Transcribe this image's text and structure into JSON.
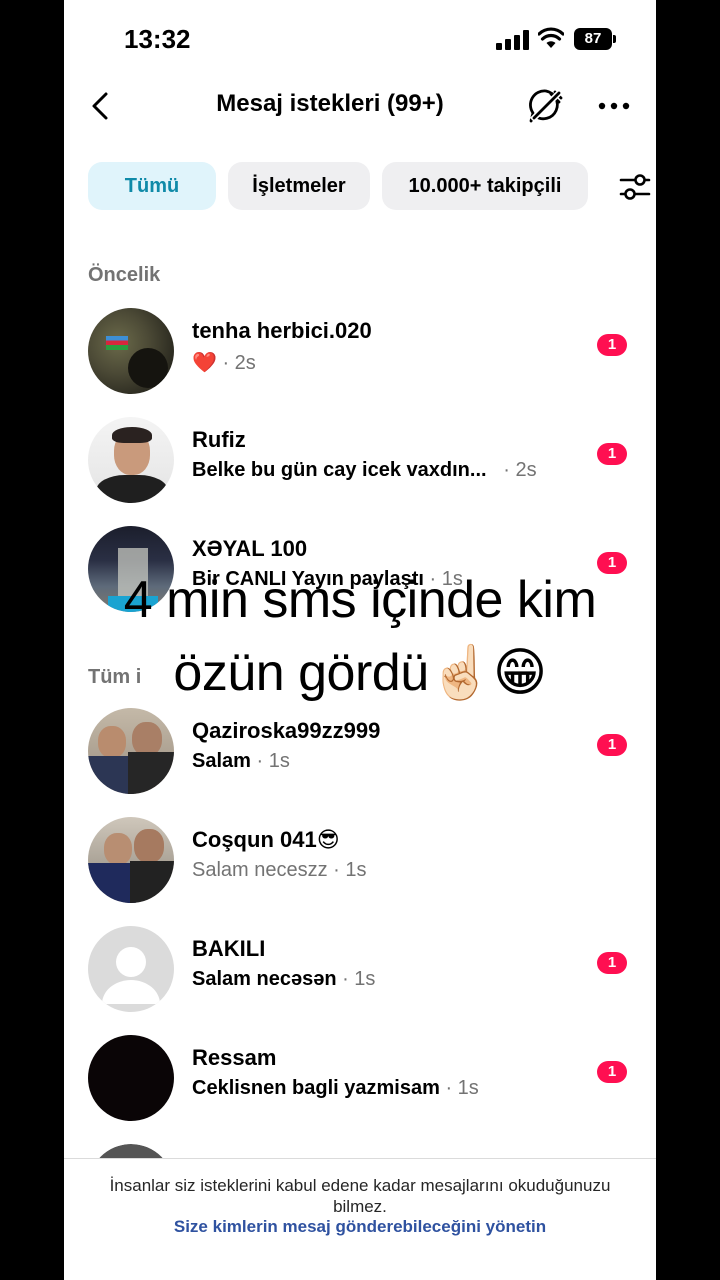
{
  "status_bar": {
    "time": "13:32",
    "battery": "87"
  },
  "header": {
    "title": "Mesaj istekleri (99+)"
  },
  "filters": {
    "all": "Tümü",
    "business": "İşletmeler",
    "followers": "10.000+ takipçili"
  },
  "sections": {
    "priority": "Öncelik",
    "all": "Tüm i"
  },
  "priority_requests": [
    {
      "name": "tenha herbici.020",
      "message": "❤️",
      "time": "· 2s",
      "badge": "1"
    },
    {
      "name": "Rufiz",
      "message": "Belke bu gün cay icek vaxdın...",
      "time": "· 2s",
      "badge": "1"
    },
    {
      "name": "XƏYAL 100",
      "message": "Bir CANLI Yayın paylaştı",
      "time": "· 1s",
      "badge": "1"
    }
  ],
  "requests": [
    {
      "name": "Qaziroska99zz999",
      "message": "Salam",
      "time": " · 1s",
      "badge": "1"
    },
    {
      "name": "Coşqun 041😎",
      "message": "Salam neceszz",
      "time": " · 1s",
      "badge": ""
    },
    {
      "name": "BAKILI",
      "message": "Salam necəsən",
      "time": " · 1s",
      "badge": "1"
    },
    {
      "name": "Ressam",
      "message": "Ceklisnen bagli yazmisam",
      "time": " · 1s",
      "badge": "1"
    }
  ],
  "overlay": {
    "line1": "4 min sms içinde kim",
    "line2": "özün gördü☝🏻😁"
  },
  "footer": {
    "text": "İnsanlar siz isteklerini kabul edene kadar mesajlarını okuduğunuzu bilmez.",
    "link": "Size kimlerin mesaj gönderebileceğini yönetin"
  },
  "colors": {
    "accent": "#0f8aa8",
    "badge": "#ff0f51",
    "link": "#2f52a0"
  }
}
